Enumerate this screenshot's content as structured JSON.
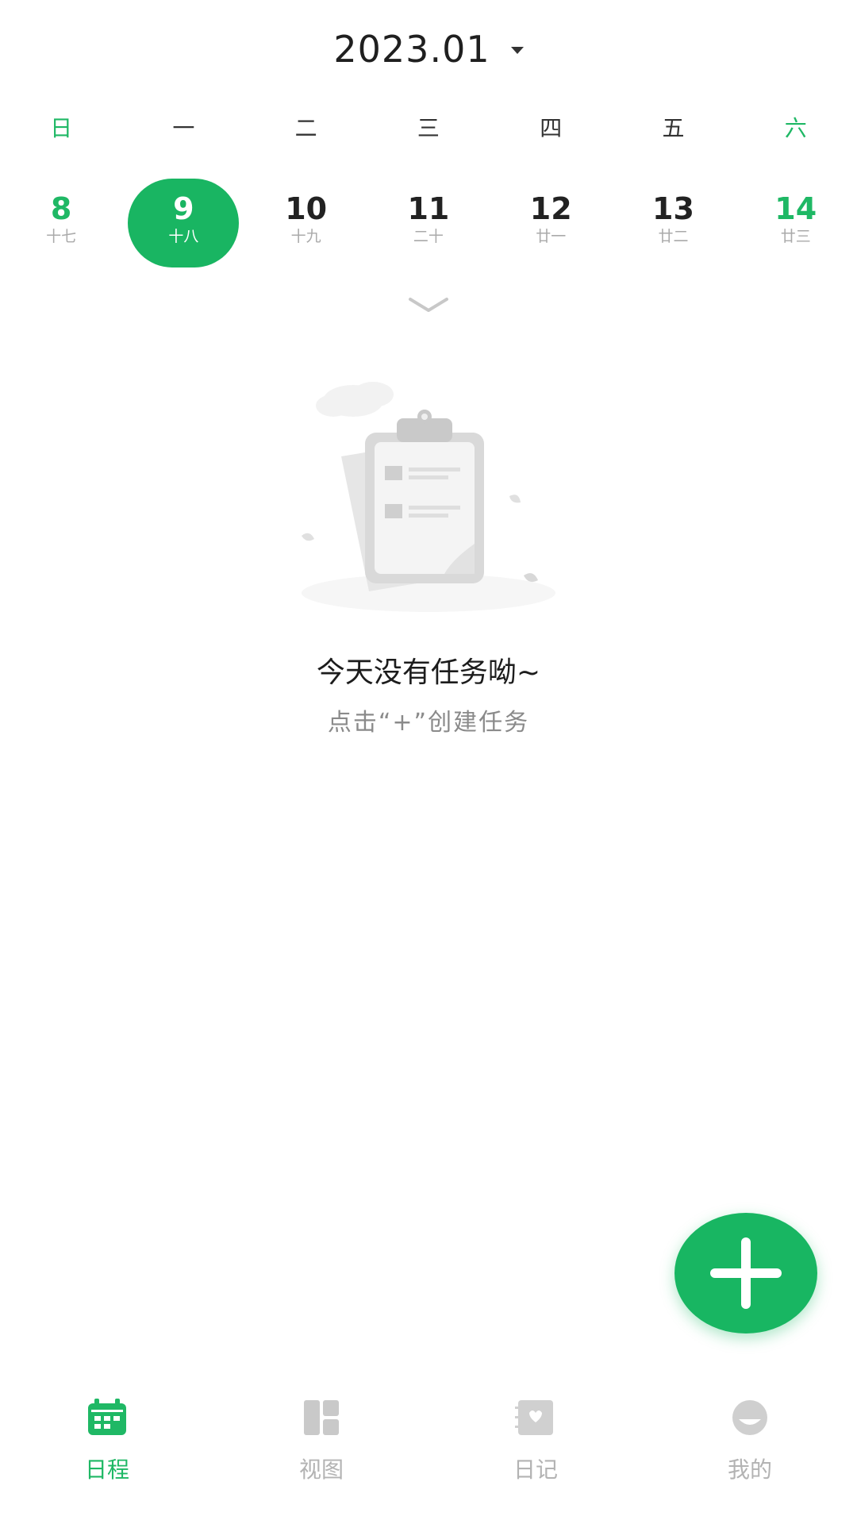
{
  "header": {
    "month": "2023.01"
  },
  "week_header": [
    "日",
    "一",
    "二",
    "三",
    "四",
    "五",
    "六"
  ],
  "dates": [
    {
      "day": "8",
      "lunar": "十七",
      "weekend": true,
      "selected": false
    },
    {
      "day": "9",
      "lunar": "十八",
      "weekend": false,
      "selected": true
    },
    {
      "day": "10",
      "lunar": "十九",
      "weekend": false,
      "selected": false
    },
    {
      "day": "11",
      "lunar": "二十",
      "weekend": false,
      "selected": false
    },
    {
      "day": "12",
      "lunar": "廿一",
      "weekend": false,
      "selected": false
    },
    {
      "day": "13",
      "lunar": "廿二",
      "weekend": false,
      "selected": false
    },
    {
      "day": "14",
      "lunar": "廿三",
      "weekend": true,
      "selected": false
    }
  ],
  "empty_state": {
    "title": "今天没有任务呦~",
    "hint": "点击“+”创建任务"
  },
  "fab": {
    "icon": "plus-icon"
  },
  "nav": {
    "items": [
      {
        "label": "日程",
        "icon": "calendar-icon",
        "active": true
      },
      {
        "label": "视图",
        "icon": "grid-icon",
        "active": false
      },
      {
        "label": "日记",
        "icon": "diary-icon",
        "active": false
      },
      {
        "label": "我的",
        "icon": "profile-icon",
        "active": false
      }
    ]
  },
  "colors": {
    "accent": "#1fb865",
    "text": "#222222",
    "muted": "#aaaaaa",
    "background": "#ffffff"
  }
}
